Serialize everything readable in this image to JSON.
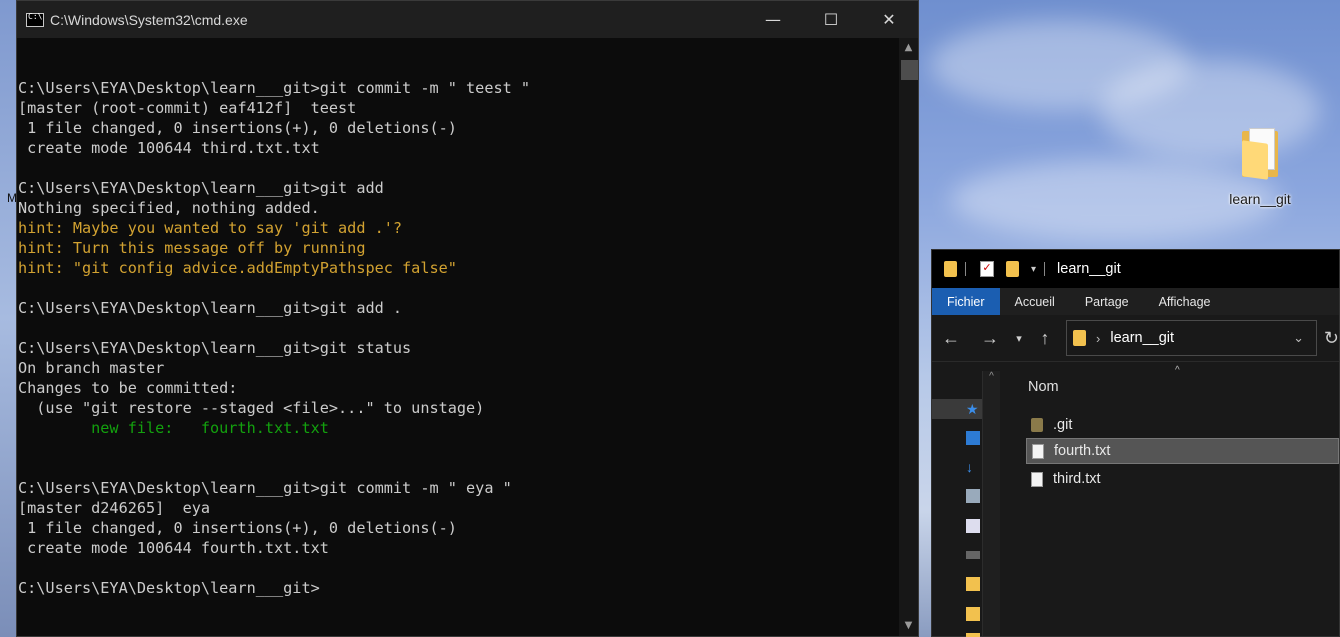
{
  "cmd": {
    "title": "C:\\Windows\\System32\\cmd.exe",
    "controls": {
      "minimize": "—",
      "maximize": "☐",
      "close": "✕"
    },
    "lines": [
      {
        "text": "C:\\Users\\EYA\\Desktop\\learn___git>git commit -m \" teest \"",
        "color": "default"
      },
      {
        "text": "[master (root-commit) eaf412f]  teest",
        "color": "default"
      },
      {
        "text": " 1 file changed, 0 insertions(+), 0 deletions(-)",
        "color": "default"
      },
      {
        "text": " create mode 100644 third.txt.txt",
        "color": "default"
      },
      {
        "text": "",
        "color": "default"
      },
      {
        "text": "C:\\Users\\EYA\\Desktop\\learn___git>git add",
        "color": "default"
      },
      {
        "text": "Nothing specified, nothing added.",
        "color": "default"
      },
      {
        "text": "hint: Maybe you wanted to say 'git add .'?",
        "color": "yellow"
      },
      {
        "text": "hint: Turn this message off by running",
        "color": "yellow"
      },
      {
        "text": "hint: \"git config advice.addEmptyPathspec false\"",
        "color": "yellow"
      },
      {
        "text": "",
        "color": "default"
      },
      {
        "text": "C:\\Users\\EYA\\Desktop\\learn___git>git add .",
        "color": "default"
      },
      {
        "text": "",
        "color": "default"
      },
      {
        "text": "C:\\Users\\EYA\\Desktop\\learn___git>git status",
        "color": "default"
      },
      {
        "text": "On branch master",
        "color": "default"
      },
      {
        "text": "Changes to be committed:",
        "color": "default"
      },
      {
        "text": "  (use \"git restore --staged <file>...\" to unstage)",
        "color": "default"
      },
      {
        "text": "        new file:   fourth.txt.txt",
        "color": "green"
      },
      {
        "text": "",
        "color": "default"
      },
      {
        "text": "",
        "color": "default"
      },
      {
        "text": "C:\\Users\\EYA\\Desktop\\learn___git>git commit -m \" eya \"",
        "color": "default"
      },
      {
        "text": "[master d246265]  eya",
        "color": "default"
      },
      {
        "text": " 1 file changed, 0 insertions(+), 0 deletions(-)",
        "color": "default"
      },
      {
        "text": " create mode 100644 fourth.txt.txt",
        "color": "default"
      },
      {
        "text": "",
        "color": "default"
      },
      {
        "text": "C:\\Users\\EYA\\Desktop\\learn___git>",
        "color": "default"
      }
    ]
  },
  "desktop": {
    "left_letter": "M",
    "icon_label": "learn__git"
  },
  "explorer": {
    "title": "learn__git",
    "tabs": [
      "Fichier",
      "Accueil",
      "Partage",
      "Affichage"
    ],
    "address_crumb": "learn__git",
    "column_header": "Nom",
    "files": [
      {
        "name": ".git",
        "type": "folder",
        "selected": false
      },
      {
        "name": "fourth.txt",
        "type": "text",
        "selected": true
      },
      {
        "name": "third.txt",
        "type": "text",
        "selected": false
      }
    ]
  },
  "colors": {
    "cmd_default": "#cccccc",
    "cmd_yellow": "#d2a231",
    "cmd_green": "#13a10e",
    "ribbon_active": "#1b5eb1"
  }
}
